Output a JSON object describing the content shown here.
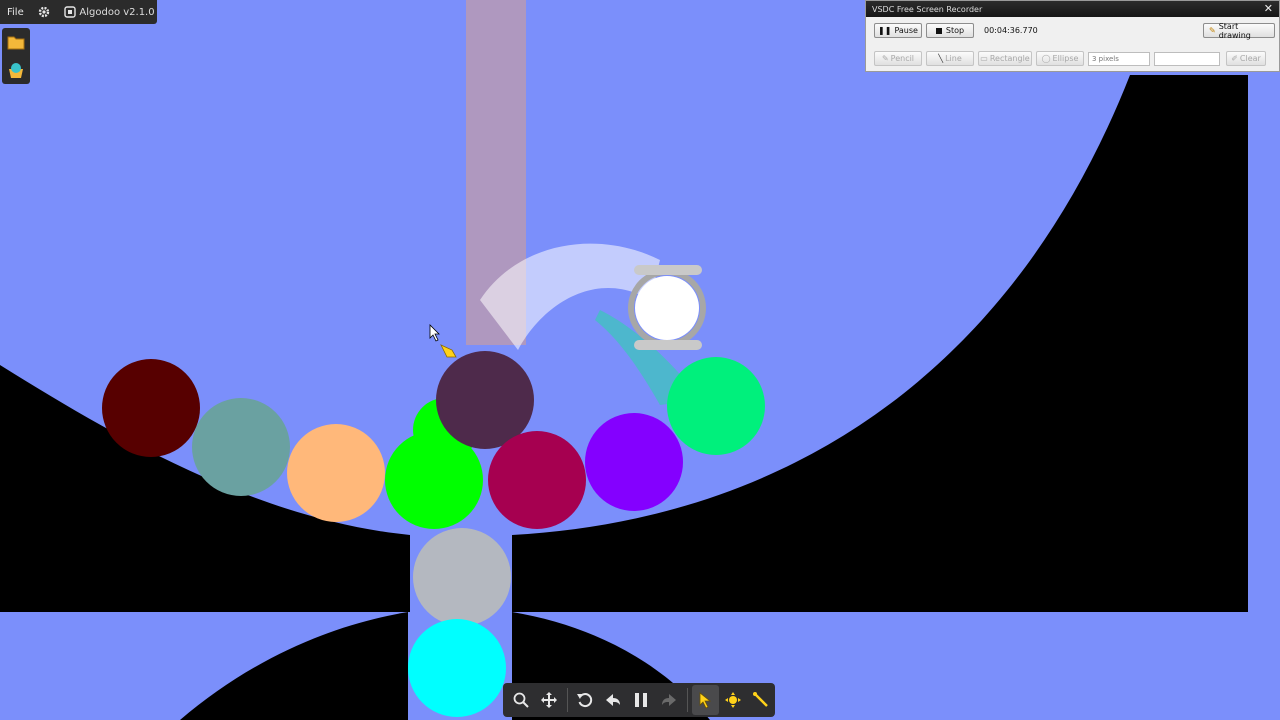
{
  "algodoo": {
    "menu_file": "File",
    "title": "Algodoo v2.1.0",
    "icons": {
      "settings": "gear-icon",
      "scene": "scene-icon",
      "open": "folder-icon",
      "palette": "palette-icon"
    }
  },
  "recorder": {
    "title": "VSDC Free Screen Recorder",
    "pause_label": "Pause",
    "stop_label": "Stop",
    "elapsed": "00:04:36.770",
    "start_drawing_label": "Start drawing",
    "pencil_label": "Pencil",
    "line_label": "Line",
    "rectangle_label": "Rectangle",
    "ellipse_label": "Ellipse",
    "thickness_value": "3 pixels",
    "clear_label": "Clear"
  },
  "toolbar": {
    "items": [
      "zoom-icon",
      "pan-icon",
      "undo-icon",
      "back-icon",
      "pause-icon",
      "forward-icon",
      "select-tool-icon",
      "move-tool-icon",
      "drag-tool-icon"
    ]
  },
  "balls": [
    {
      "name": "dark-red-ball",
      "color": "#570000"
    },
    {
      "name": "teal-gray-ball",
      "color": "#6aa1a1"
    },
    {
      "name": "peach-ball",
      "color": "#ffb87a"
    },
    {
      "name": "green-ball",
      "color": "#00ff00"
    },
    {
      "name": "plum-ball",
      "color": "#4e2a4b"
    },
    {
      "name": "crimson-ball",
      "color": "#a60050"
    },
    {
      "name": "violet-ball",
      "color": "#8400ff"
    },
    {
      "name": "mint-ball",
      "color": "#00f07c"
    },
    {
      "name": "silver-ball",
      "color": "#b4b8c0"
    },
    {
      "name": "cyan-ball",
      "color": "#00ffff"
    },
    {
      "name": "white-ball",
      "color": "#ffffff"
    }
  ],
  "colors": {
    "background": "#7b8ffb",
    "terrain": "#000000"
  }
}
